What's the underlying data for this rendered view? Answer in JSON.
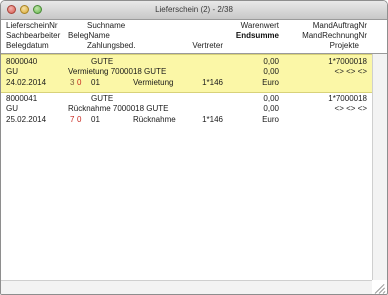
{
  "window": {
    "title": "Lieferschein (2) - 2/38"
  },
  "header": {
    "line1": {
      "lieferscheinnr": "LieferscheinNr",
      "suchname": "Suchname",
      "warenwert": "Warenwert",
      "mandauftragnr": "MandAuftragNr"
    },
    "line2": {
      "sachbearbeiter": "Sachbearbeiter",
      "belegname": "BelegName",
      "endsumme": "Endsumme",
      "mandrechnungnr": "MandRechnungNr"
    },
    "line3": {
      "belegdatum": "Belegdatum",
      "zahlungsbed": "Zahlungsbed.",
      "vertreter": "Vertreter",
      "projekte": "Projekte"
    }
  },
  "rows": [
    {
      "lieferscheinnr": "8000040",
      "suchname": "GUTE",
      "warenwert": "0,00",
      "mandauftragnr": "1*7000018",
      "sachbearbeiter": "GU",
      "belegname": "Vermietung 7000018 GUTE",
      "endsumme": "0,00",
      "mandrechnungnr": "<> <> <>",
      "belegdatum": "24.02.2014",
      "flag1": "3",
      "flag2": "0",
      "zahlungsbed": "01",
      "art": "Vermietung",
      "vertreter": "1*146",
      "waehrung": "Euro",
      "highlighted": true
    },
    {
      "lieferscheinnr": "8000041",
      "suchname": "GUTE",
      "warenwert": "0,00",
      "mandauftragnr": "1*7000018",
      "sachbearbeiter": "GU",
      "belegname": "Rücknahme 7000018 GUTE",
      "endsumme": "0,00",
      "mandrechnungnr": "<> <> <>",
      "belegdatum": "25.02.2014",
      "flag1": "7",
      "flag2": "0",
      "zahlungsbed": "01",
      "art": "Rücknahme",
      "vertreter": "1*146",
      "waehrung": "Euro",
      "highlighted": false
    }
  ],
  "colors": {
    "highlight_row": "#fbf7a7",
    "flag_red": "#c8281f"
  }
}
